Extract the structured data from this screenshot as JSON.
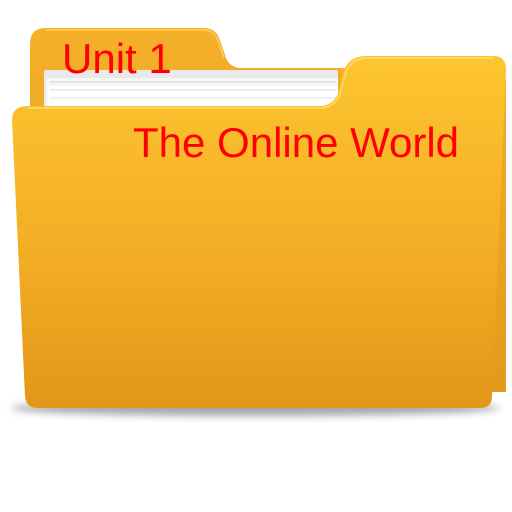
{
  "folder": {
    "tab_label": "Unit 1",
    "title": "The Online World",
    "icon": "folder-icon",
    "documents_icon": "documents-icon"
  },
  "colors": {
    "text": "#ff0000",
    "folder_light": "#fcc22f",
    "folder_dark": "#e2961a",
    "folder_back": "#f2aa26",
    "paper": "#ffffff"
  }
}
